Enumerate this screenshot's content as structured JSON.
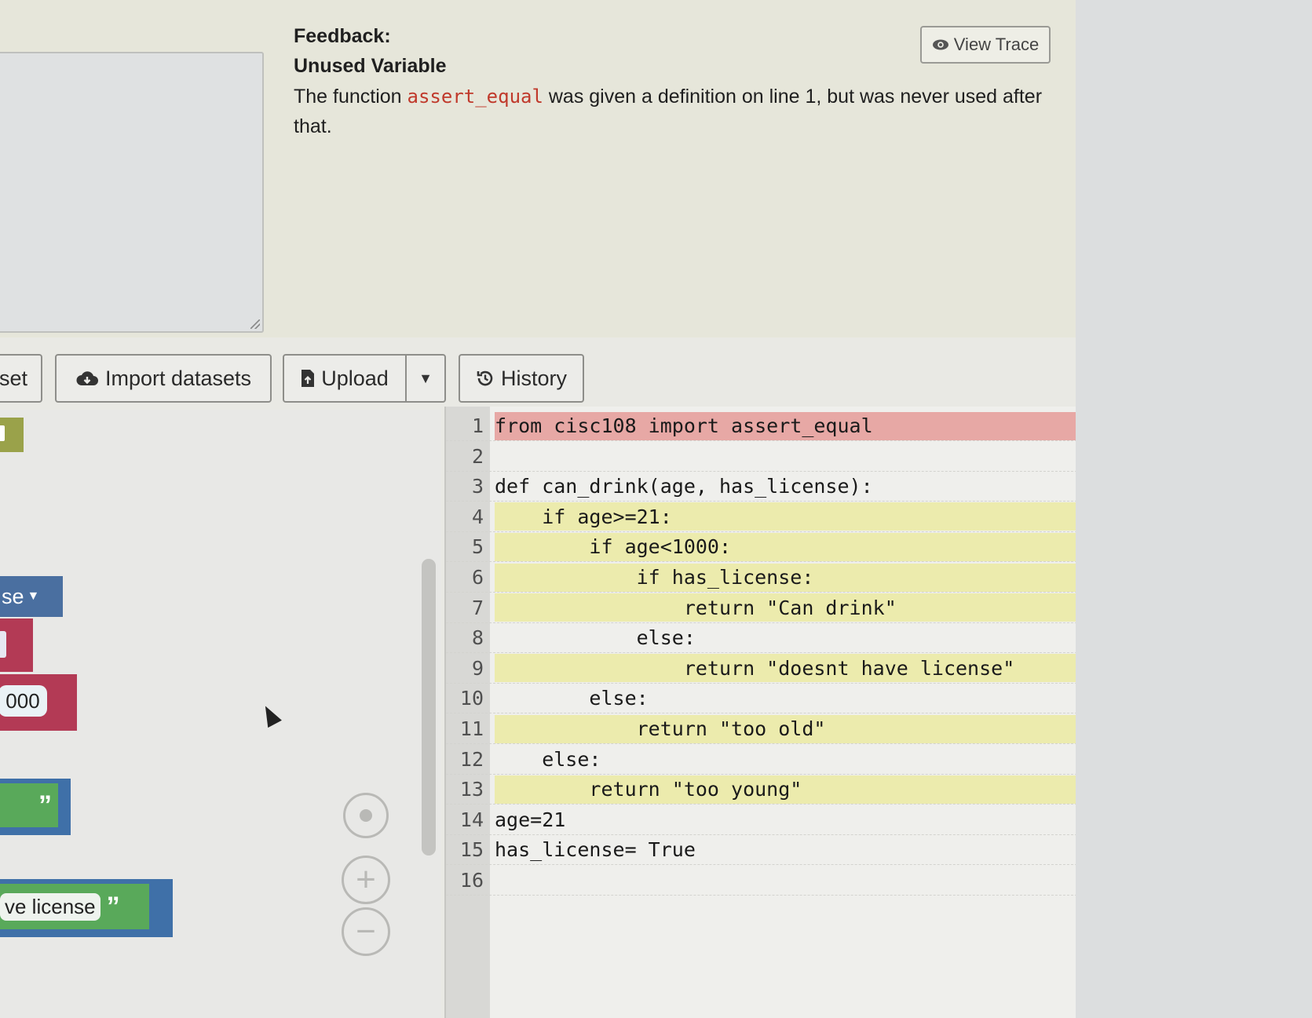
{
  "feedback": {
    "heading": "Feedback:",
    "title": "Unused Variable",
    "message_before": "The function ",
    "message_code": "assert_equal",
    "message_after": " was given a definition on line 1, but was never used after that.",
    "view_trace_label": "View Trace"
  },
  "toolbar": {
    "reset_label": "set",
    "import_label": "Import datasets",
    "upload_label": "Upload",
    "history_label": "History"
  },
  "blocks": {
    "bool_label": "se",
    "number_value": "000",
    "quote_glyph": "”",
    "text_value": "ve license"
  },
  "workspace": {
    "zoom_in_glyph": "+",
    "zoom_out_glyph": "−"
  },
  "code": {
    "lines": [
      {
        "n": "1",
        "text": "from cisc108 import assert_equal",
        "hl": "err"
      },
      {
        "n": "2",
        "text": "",
        "hl": ""
      },
      {
        "n": "3",
        "text": "def can_drink(age, has_license):",
        "hl": ""
      },
      {
        "n": "4",
        "text": "    if age>=21:",
        "hl": "warn"
      },
      {
        "n": "5",
        "text": "        if age<1000:",
        "hl": "warn"
      },
      {
        "n": "6",
        "text": "            if has_license:",
        "hl": "warn"
      },
      {
        "n": "7",
        "text": "                return \"Can drink\"",
        "hl": "warn"
      },
      {
        "n": "8",
        "text": "            else:",
        "hl": ""
      },
      {
        "n": "9",
        "text": "                return \"doesnt have license\"",
        "hl": "warn"
      },
      {
        "n": "10",
        "text": "        else:",
        "hl": ""
      },
      {
        "n": "11",
        "text": "            return \"too old\"",
        "hl": "warn"
      },
      {
        "n": "12",
        "text": "    else:",
        "hl": ""
      },
      {
        "n": "13",
        "text": "        return \"too young\"",
        "hl": "warn"
      },
      {
        "n": "14",
        "text": "age=21",
        "hl": ""
      },
      {
        "n": "15",
        "text": "has_license= True",
        "hl": ""
      },
      {
        "n": "16",
        "text": "",
        "hl": ""
      }
    ]
  },
  "colors": {
    "error_line": "#e7a8a5",
    "warning_line": "#ecebad",
    "code_token": "#c0392b"
  }
}
